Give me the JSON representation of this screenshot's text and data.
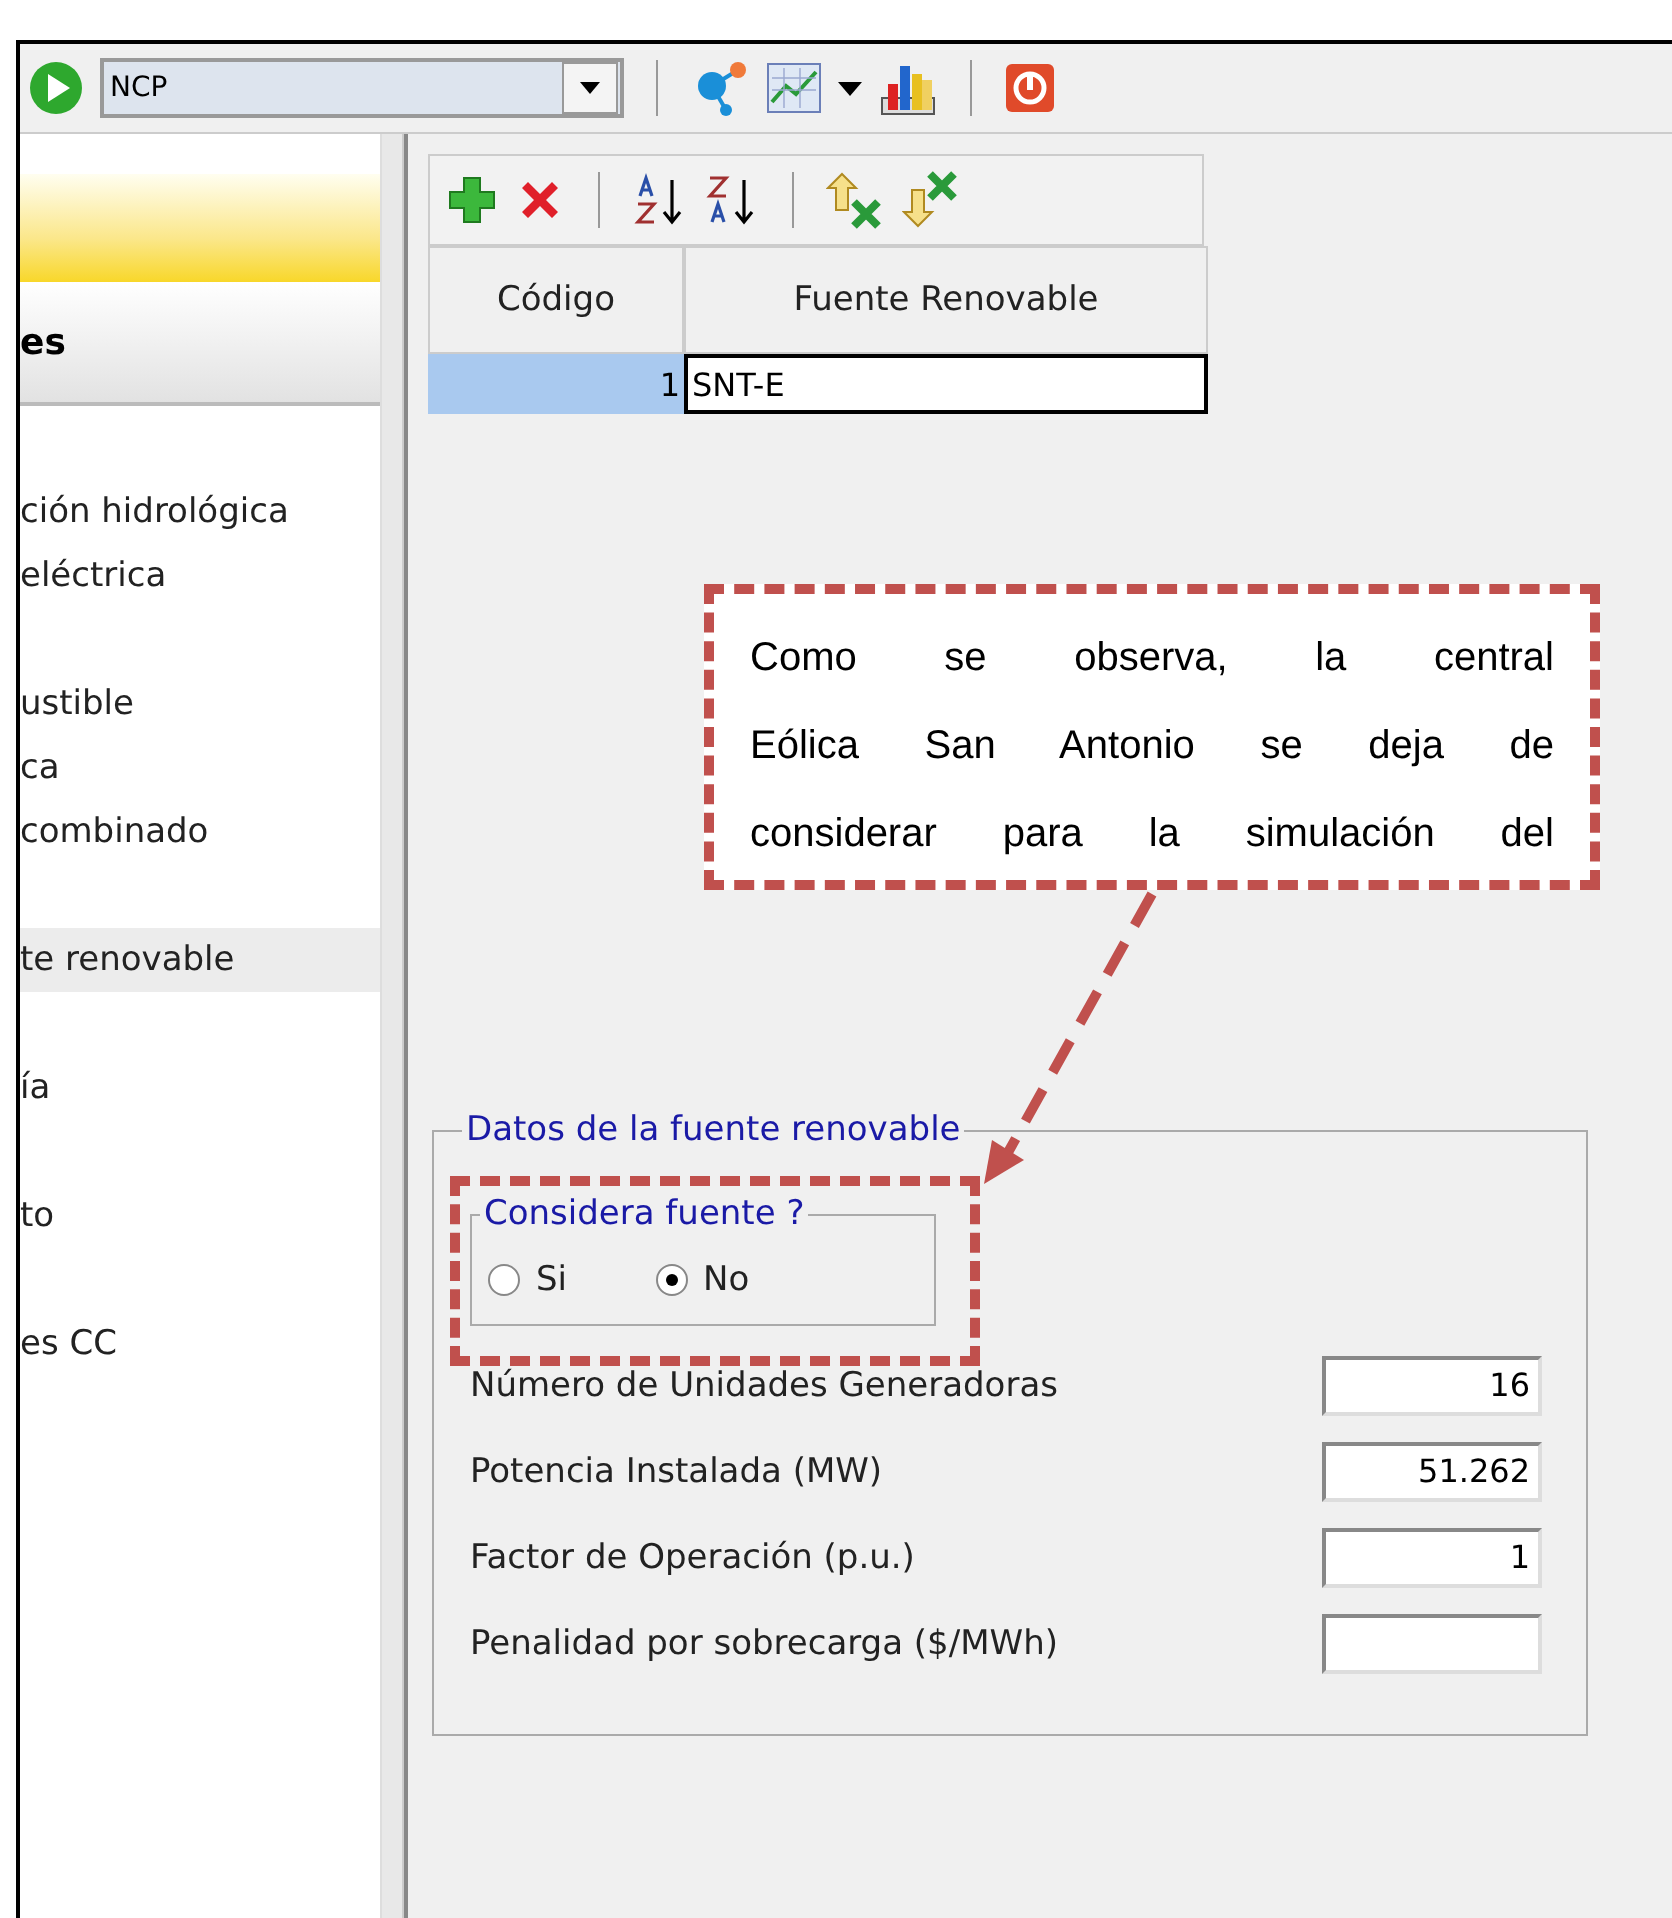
{
  "toolbar": {
    "scenario": "NCP"
  },
  "sidebar": {
    "header": "es",
    "groups": [
      {
        "items": [
          {
            "label": "ción hidrológica",
            "selected": false
          },
          {
            "label": "eléctrica",
            "selected": false
          }
        ]
      },
      {
        "items": [
          {
            "label": "ustible",
            "selected": false
          },
          {
            "label": "ca",
            "selected": false
          },
          {
            "label": "combinado",
            "selected": false
          }
        ]
      },
      {
        "items": [
          {
            "label": "te renovable",
            "selected": true
          }
        ]
      },
      {
        "items": [
          {
            "label": "ía",
            "selected": false
          }
        ]
      },
      {
        "items": [
          {
            "label": "to",
            "selected": false
          }
        ]
      },
      {
        "items": [
          {
            "label": "es CC",
            "selected": false
          }
        ]
      }
    ]
  },
  "table": {
    "columns": [
      "Código",
      "Fuente Renovable"
    ],
    "rows": [
      {
        "cells": [
          "1",
          "SNT-E"
        ],
        "selected": true
      }
    ]
  },
  "callout": "Como se observa, la central Eólica San Antonio se deja de considerar para la simulación del",
  "group": {
    "title": "Datos de la fuente renovable",
    "radio_group": {
      "title": "Considera fuente ?",
      "options": [
        {
          "label": "Si",
          "selected": false
        },
        {
          "label": "No",
          "selected": true
        }
      ]
    },
    "fields": [
      {
        "label": "Número de Unidades Generadoras",
        "value": "16"
      },
      {
        "label": "Potencia Instalada (MW)",
        "value": "51.262"
      },
      {
        "label": "Factor de Operación (p.u.)",
        "value": "1"
      },
      {
        "label": "Penalidad por sobrecarga ($/MWh)"
      }
    ]
  }
}
